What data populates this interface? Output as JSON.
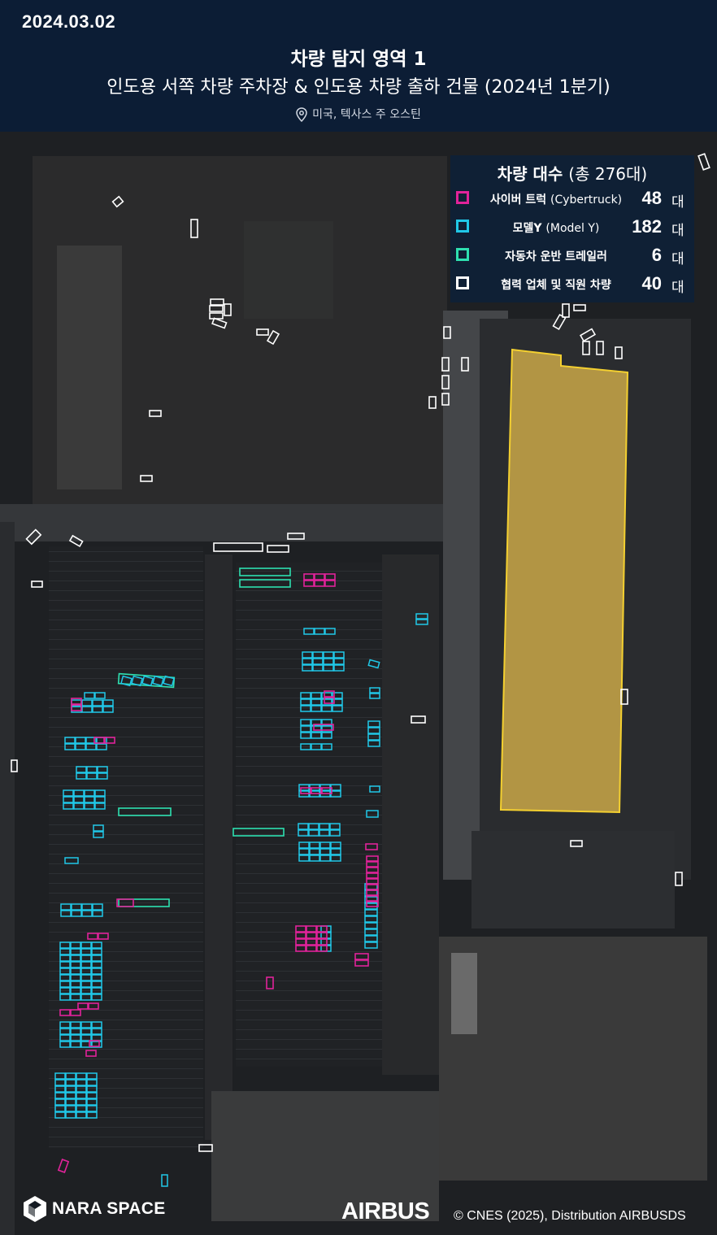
{
  "header": {
    "date": "2024.03.02",
    "title": "차량 탐지 영역 1",
    "subtitle": "인도용 서쪽 차량 주차장 & 인도용 차량 출하 건물 (2024년 1분기)",
    "location": "미국, 텍사스 주 오스틴",
    "location_icon": "location-pin-icon"
  },
  "legend": {
    "title": "차량 대수",
    "total": "(총 276대)",
    "unit": "대",
    "items": [
      {
        "label": "사이버 트럭",
        "label_en": "(Cybertruck)",
        "count": "48",
        "color": "#e0239a"
      },
      {
        "label": "모델Y",
        "label_en": "(Model Y)",
        "count": "182",
        "color": "#20c8e8"
      },
      {
        "label": "자동차 운반 트레일러",
        "label_en": "",
        "count": "6",
        "color": "#2ee0b0"
      },
      {
        "label": "협력 업체 및 직원 차량",
        "label_en": "",
        "count": "40",
        "color": "#ffffff"
      }
    ]
  },
  "map": {
    "building_fill": "#d8b44a",
    "building_stroke": "#f4d030"
  },
  "footer": {
    "brand": "NARA SPACE",
    "airbus": "AIRBUS",
    "credit": "© CNES (2025), Distribution AIRBUSDS"
  }
}
